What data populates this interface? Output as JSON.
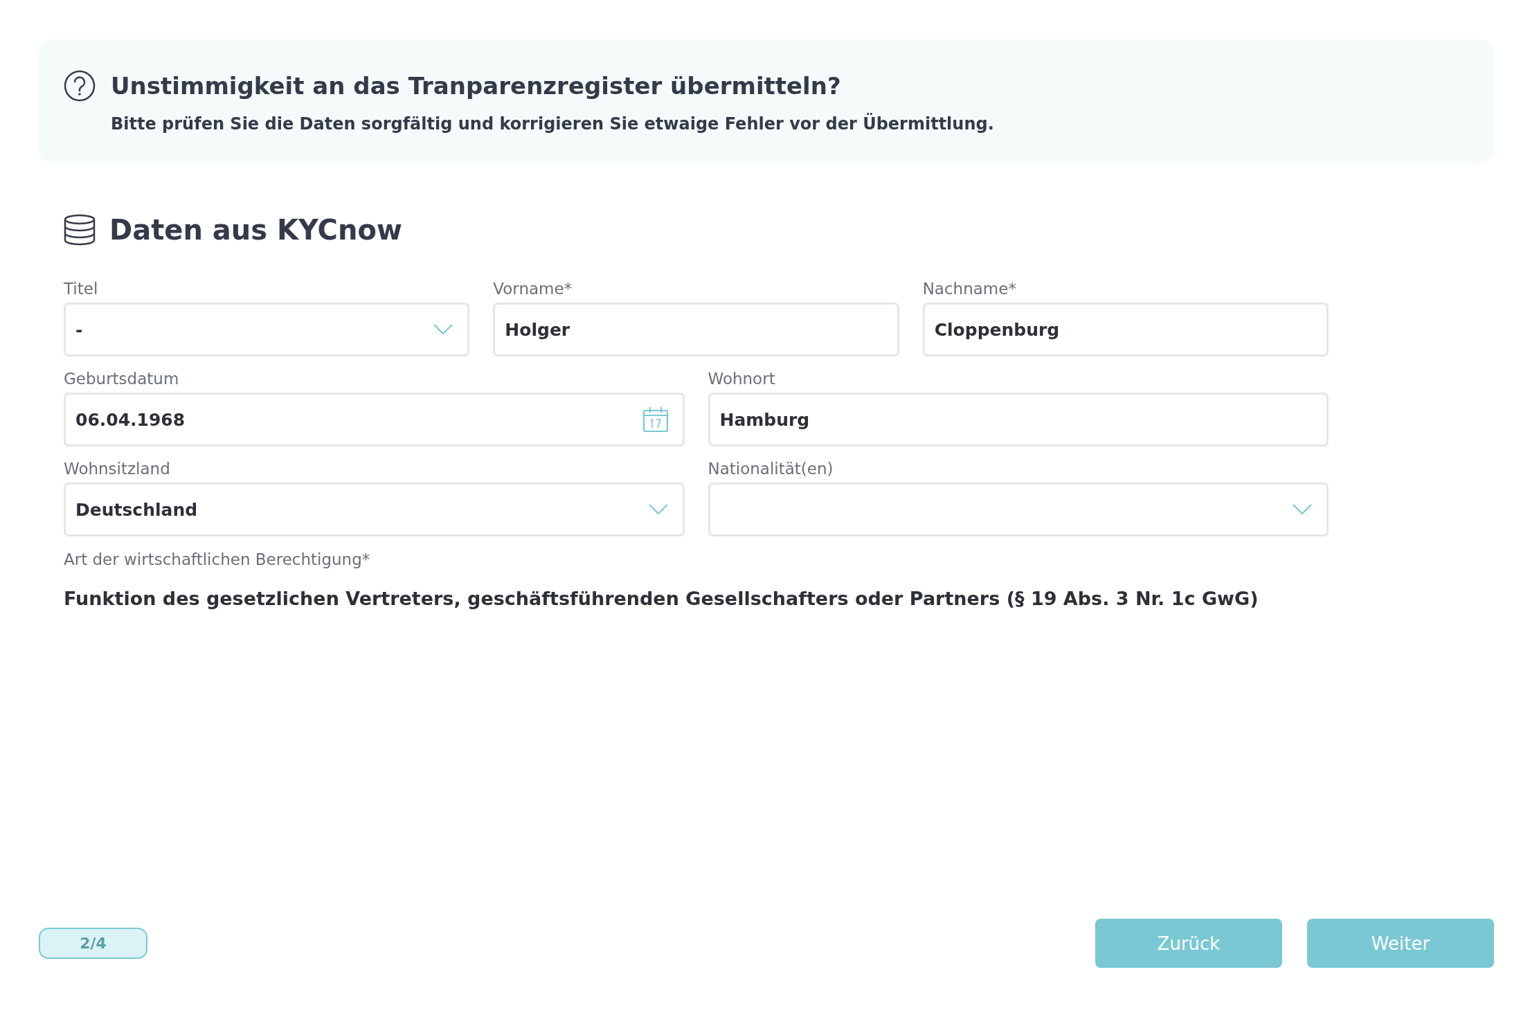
{
  "notice": {
    "title": "Unstimmigkeit an das Tranparenzregister übermitteln?",
    "text": "Bitte prüfen Sie die Daten sorgfältig und korrigieren Sie etwaige Fehler vor der Übermittlung."
  },
  "section": {
    "title": "Daten aus KYCnow"
  },
  "field_rows": [
    [
      {
        "label": "Titel",
        "kind": "select",
        "value": "-"
      },
      {
        "label": "Vorname*",
        "kind": "text",
        "value": "Holger"
      },
      {
        "label": "Nachname*",
        "kind": "text",
        "value": "Cloppenburg"
      }
    ],
    [
      {
        "label": "Geburtsdatum",
        "kind": "date",
        "value": "06.04.1968"
      },
      {
        "label": "Wohnort",
        "kind": "text",
        "value": "Hamburg"
      }
    ],
    [
      {
        "label": "Wohnsitzland",
        "kind": "select",
        "value": "Deutschland"
      },
      {
        "label": "Nationalität(en)",
        "kind": "select"
      }
    ]
  ],
  "beneficial_ownership": {
    "label": "Art der wirtschaftlichen Berechtigung*",
    "value": "Funktion des gesetzlichen Vertreters, geschäftsführenden Gesellschafters oder Partners (§ 19 Abs. 3 Nr. 1c GwG)"
  },
  "footer": {
    "step": "2/4",
    "buttons": [
      "Zurück",
      "Weiter"
    ]
  }
}
